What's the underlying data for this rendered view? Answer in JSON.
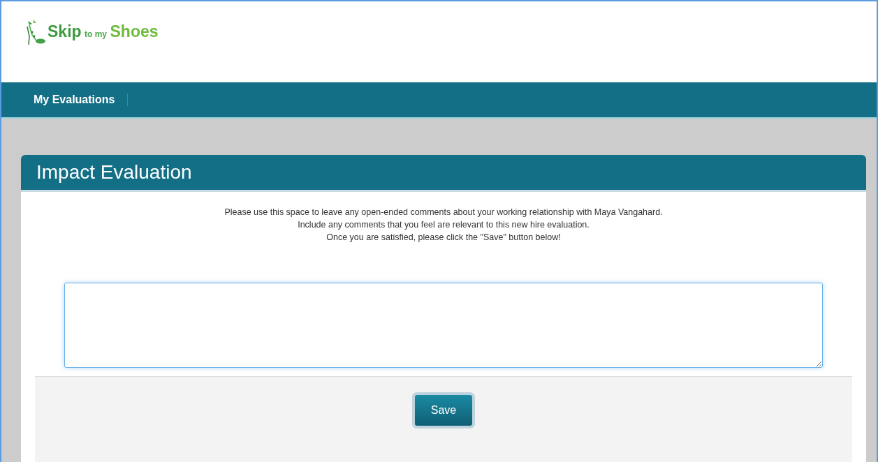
{
  "logo": {
    "words": [
      "Skip",
      "to my",
      "Shoes"
    ]
  },
  "nav": {
    "items": [
      {
        "label": "My Evaluations",
        "selected": true
      }
    ]
  },
  "card": {
    "title": "Impact Evaluation",
    "instructions": [
      "Please use this space to leave any open-ended comments about your working relationship with Maya Vangahard.",
      "Include any comments that you feel are relevant to this new hire evaluation.",
      "Once you are satisfied, please click the \"Save\" button below!"
    ],
    "buttons": [
      "Save"
    ]
  }
}
